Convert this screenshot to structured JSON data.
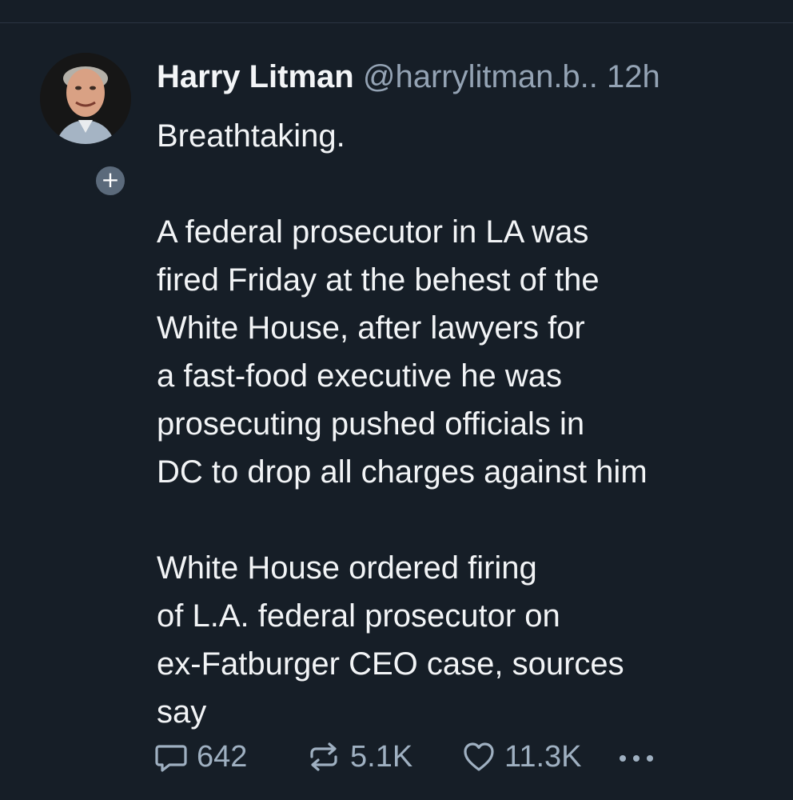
{
  "post": {
    "author": {
      "display_name": "Harry Litman",
      "handle": "@harrylitman.b..",
      "timestamp": "12h",
      "avatar_icon": "author-avatar-photo",
      "follow_badge": "+"
    },
    "text": "Breathtaking.\n\nA federal prosecutor in LA was\nfired Friday at the behest of the\nWhite House, after lawyers for\na fast-food executive he was\nprosecuting pushed officials in\nDC to drop all charges against him\n\nWhite House ordered firing\nof L.A. federal prosecutor on\nex-Fatburger CEO case, sources\nsay",
    "actions": {
      "reply": {
        "icon": "reply-bubble-icon",
        "count": "642"
      },
      "repost": {
        "icon": "repost-arrows-icon",
        "count": "5.1K"
      },
      "like": {
        "icon": "heart-icon",
        "count": "11.3K"
      },
      "more": {
        "icon": "more-dots-icon"
      }
    }
  },
  "theme": {
    "background": "#161e27",
    "text": "#f2f4f6",
    "muted": "#94a3b4",
    "badge": "#5b6a7b"
  }
}
